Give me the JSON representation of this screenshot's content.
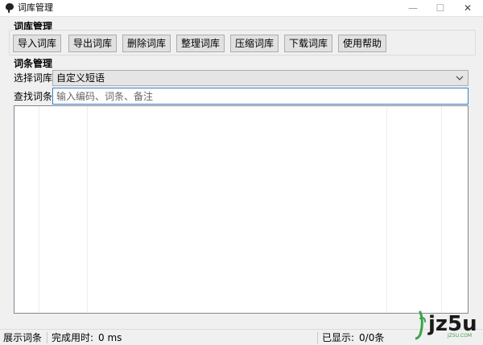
{
  "window": {
    "title": "词库管理",
    "minimize_glyph": "—",
    "maximize_glyph": "☐",
    "close_glyph": "✕"
  },
  "library_section": {
    "label": "词库管理",
    "buttons": [
      {
        "label": "导入词库"
      },
      {
        "label": "导出词库"
      },
      {
        "label": "删除词库"
      },
      {
        "label": "整理词库"
      },
      {
        "label": "压缩词库"
      },
      {
        "label": "下载词库"
      },
      {
        "label": "使用帮助"
      }
    ]
  },
  "entry_section": {
    "label": "词条管理",
    "select_label": "选择词库",
    "select_value": "自定义短语",
    "search_label": "查找词条",
    "search_placeholder": "输入编码、词条、备注",
    "search_value": ""
  },
  "status": {
    "mode": "展示词条",
    "elapsed_label": "完成用时:",
    "elapsed_value": "0 ms",
    "shown_label": "已显示:",
    "shown_value": "0/0条"
  },
  "watermark": {
    "logo_text": "jz5u",
    "logo_sub": "JZ5U.COM"
  },
  "colors": {
    "accent": "#3b7fd0",
    "logo_green": "#3aa24a",
    "logo_dark": "#1a1a1a"
  }
}
